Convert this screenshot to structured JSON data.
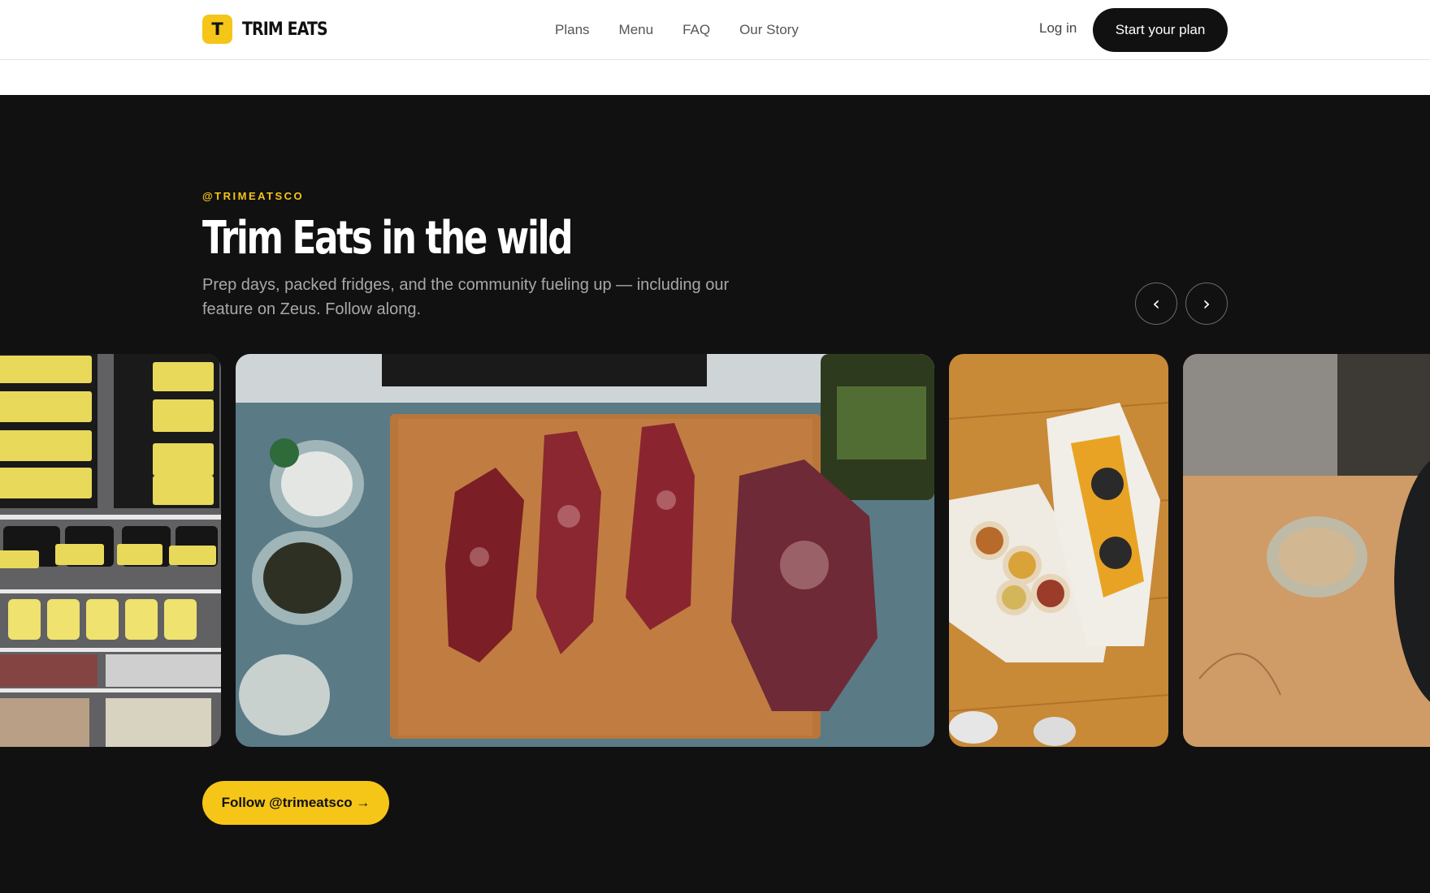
{
  "header": {
    "logo_mark": "T",
    "brand": "TRIM EATS",
    "nav": [
      "Plans",
      "Menu",
      "FAQ",
      "Our Story"
    ],
    "login": "Log in",
    "cta": "Start your plan"
  },
  "section": {
    "eyebrow": "@TRIMEATSCO",
    "title": "Trim Eats in the wild",
    "subtitle": "Prep days, packed fridges, and the community fueling up — including our feature on Zeus. Follow along.",
    "prev_icon": "‹",
    "next_icon": "›",
    "follow": "Follow @trimeatsco →"
  },
  "carousel": {
    "items": [
      {
        "alt": "Fridge packed with Trim Eats meal containers"
      },
      {
        "alt": "Raw steaks on a wooden cutting board with seasoning bowls"
      },
      {
        "alt": "Trim Eats delivery bags with meal cups on a wooden floor"
      },
      {
        "alt": "Glass bowl on a wooden cutting board beside a mixing bowl"
      }
    ]
  },
  "colors": {
    "accent": "#f5c518",
    "dark_bg": "#111111",
    "cta_bg": "#111111"
  }
}
